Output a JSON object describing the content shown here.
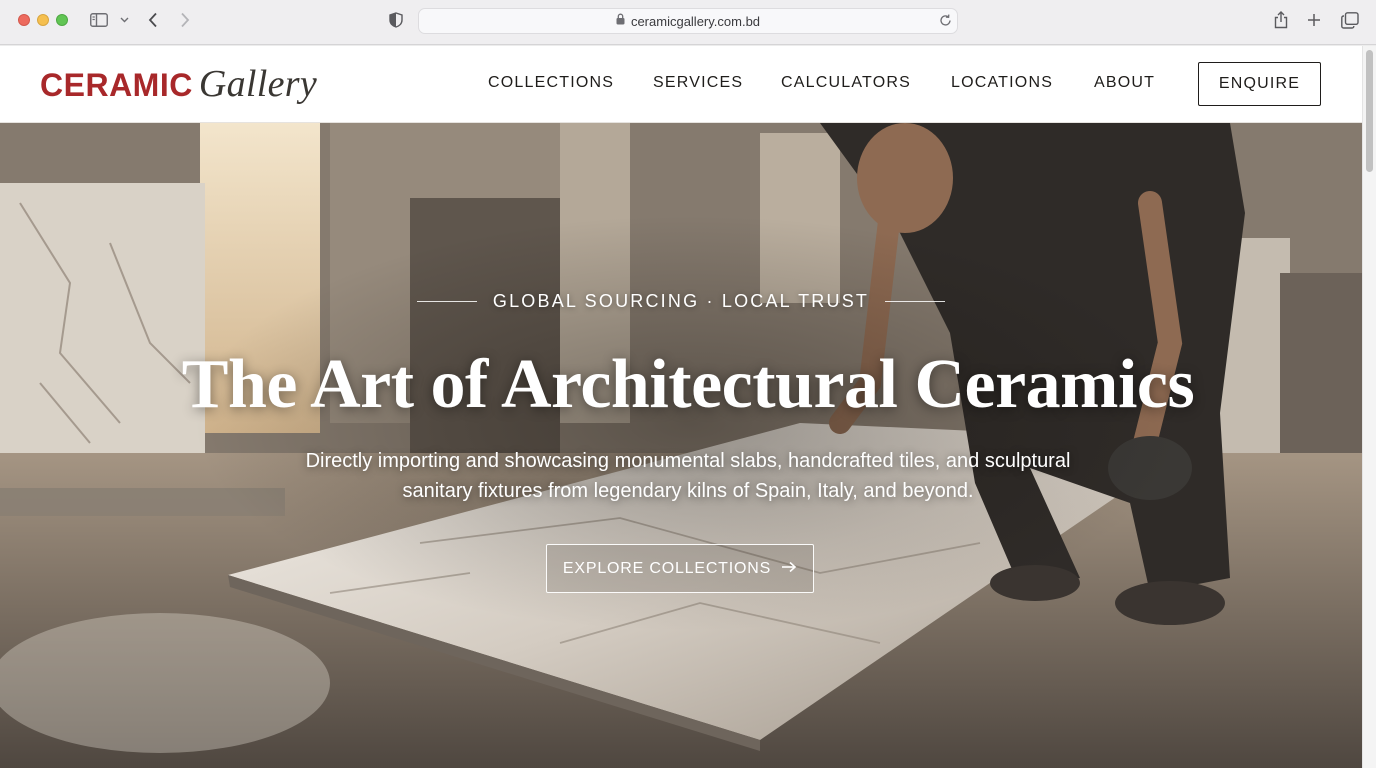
{
  "browser": {
    "url": "ceramicgallery.com.bd",
    "icons": [
      "sidebar-icon",
      "chevron-down-icon",
      "back-icon",
      "forward-icon",
      "privacy-shield-icon",
      "lock-icon",
      "reload-icon",
      "share-icon",
      "new-tab-icon",
      "tabs-overview-icon"
    ]
  },
  "header": {
    "logo_main": "CERAMIC",
    "logo_script": "Gallery",
    "logo_color": "#a8282a",
    "nav": [
      {
        "label": "COLLECTIONS"
      },
      {
        "label": "SERVICES"
      },
      {
        "label": "CALCULATORS"
      },
      {
        "label": "LOCATIONS"
      },
      {
        "label": "ABOUT"
      }
    ],
    "enquire_label": "ENQUIRE"
  },
  "hero": {
    "eyebrow": "GLOBAL SOURCING · LOCAL TRUST",
    "title": "The Art of Architectural Ceramics",
    "subtitle": "Directly importing and showcasing monumental slabs, handcrafted tiles, and sculptural sanitary fixtures from legendary kilns of Spain, Italy, and beyond.",
    "cta_label": "EXPLORE COLLECTIONS",
    "cta_icon": "arrow-right-icon"
  }
}
